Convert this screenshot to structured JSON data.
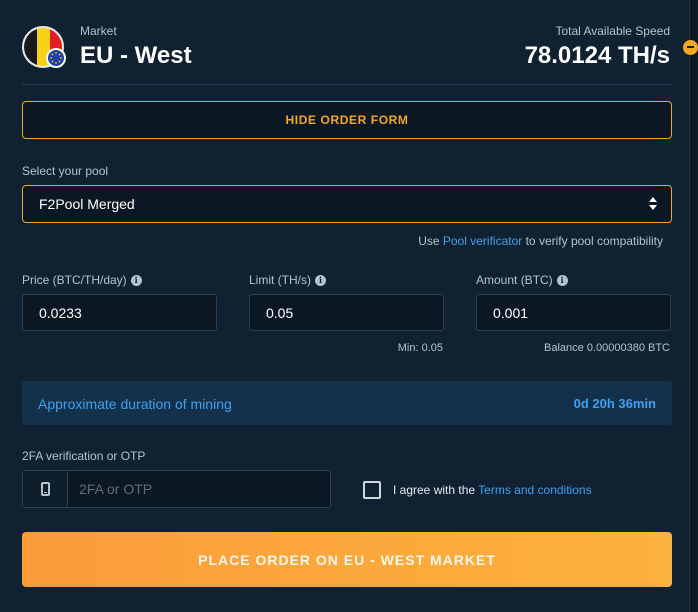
{
  "header": {
    "market_label": "Market",
    "market_name": "EU - West",
    "speed_label": "Total Available Speed",
    "speed_value": "78.0124 TH/s"
  },
  "form": {
    "hide_button": "HIDE ORDER FORM",
    "pool_label": "Select your pool",
    "pool_selected": "F2Pool Merged",
    "verifier_prefix": "Use ",
    "verifier_link": "Pool verificator",
    "verifier_suffix": " to verify pool compatibility",
    "price_label": "Price (BTC/TH/day)",
    "price_value": "0.0233",
    "limit_label": "Limit (TH/s)",
    "limit_value": "0.05",
    "limit_hint": "Min: 0.05",
    "amount_label": "Amount (BTC)",
    "amount_value": "0.001",
    "amount_hint": "Balance 0.00000380 BTC",
    "duration_label": "Approximate duration of mining",
    "duration_value": "0d 20h 36min",
    "otp_label": "2FA verification or OTP",
    "otp_placeholder": "2FA or OTP",
    "agree_prefix": "I agree with the ",
    "terms_link": "Terms and conditions",
    "place_button": "PLACE ORDER ON EU - WEST MARKET"
  },
  "icons": {
    "flag": "belgium-flag-icon",
    "eu_badge": "eu-stars-icon",
    "info": "info-icon",
    "select_arrows": "sort-arrows-icon",
    "phone": "mobile-phone-icon",
    "collapse": "minus-circle-icon"
  },
  "colors": {
    "accent": "#f5a623",
    "link": "#3fa0f0",
    "background": "#102231",
    "duration_bg": "#13314a"
  }
}
